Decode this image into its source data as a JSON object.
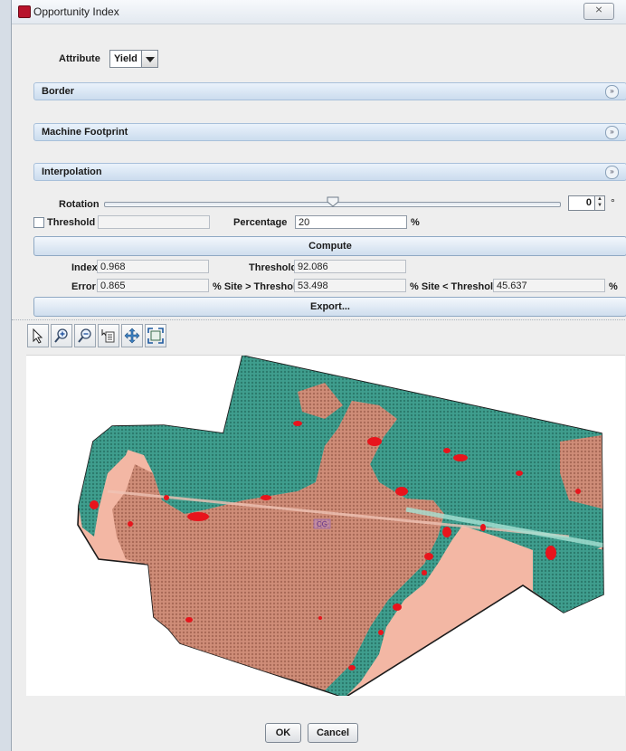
{
  "window": {
    "title": "Opportunity Index",
    "close_glyph": "⨯"
  },
  "attribute": {
    "label": "Attribute",
    "value": "Yield"
  },
  "sections": {
    "border": "Border",
    "machine_footprint": "Machine Footprint",
    "interpolation": "Interpolation"
  },
  "rotation": {
    "label": "Rotation",
    "value": "0",
    "unit": "°",
    "slider_fraction": 0.5
  },
  "threshold_row": {
    "checkbox_label": "Threshold",
    "checked": false,
    "percentage_label": "Percentage",
    "percentage_value": "20",
    "percentage_unit": "%"
  },
  "compute_button": "Compute",
  "results": {
    "index_label": "Index",
    "index_value": "0.968",
    "threshold_label": "Threshold",
    "threshold_value": "92.086",
    "error_label": "Error",
    "error_value": "0.865",
    "site_gt_label": "% Site > Threshold",
    "site_gt_value": "53.498",
    "site_lt_label": "% Site < Threshold",
    "site_lt_value": "45.637",
    "trailing_unit": "%"
  },
  "export_button": "Export...",
  "toolbar_icons": [
    "select-arrow-icon",
    "zoom-in-icon",
    "zoom-out-icon",
    "layers-icon",
    "pan-icon",
    "zoom-extent-icon"
  ],
  "map": {
    "center_label": "CG",
    "colors": {
      "above_threshold": "#3f9e8e",
      "below_threshold": "#cf8d78",
      "hotspots": "#e8141c",
      "buffer_high": "#9fe0d1",
      "buffer_low": "#f3b7a4"
    }
  },
  "buttons": {
    "ok": "OK",
    "cancel": "Cancel"
  }
}
